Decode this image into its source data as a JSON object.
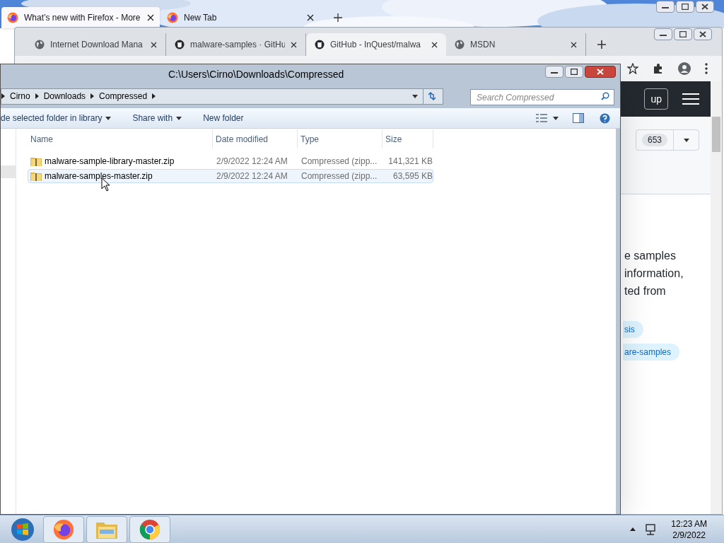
{
  "firefox": {
    "tabs": [
      {
        "title": "What’s new with Firefox - More",
        "selected": true
      },
      {
        "title": "New Tab",
        "selected": false
      }
    ]
  },
  "chrome": {
    "tabs": [
      {
        "title": "Internet Download Mana",
        "kind": "globe",
        "selected": false
      },
      {
        "title": "malware-samples · GitHu",
        "kind": "github",
        "selected": false
      },
      {
        "title": "GitHub - InQuest/malwa",
        "kind": "github",
        "selected": true
      },
      {
        "title": "MSDN",
        "kind": "globe",
        "selected": false
      }
    ],
    "page": {
      "header_button": "up",
      "count": "653",
      "text_lines": [
        "e samples",
        "information,",
        "ted from"
      ],
      "tags": [
        "sis",
        "are-samples"
      ]
    }
  },
  "explorer": {
    "title": "C:\\Users\\Cirno\\Downloads\\Compressed",
    "breadcrumb": [
      "Cirno",
      "Downloads",
      "Compressed"
    ],
    "search": {
      "placeholder": "Search Compressed"
    },
    "toolbar": [
      {
        "label": "de selected folder in library",
        "dropdown": true
      },
      {
        "label": "Share with",
        "dropdown": true
      },
      {
        "label": "New folder",
        "dropdown": false
      }
    ],
    "columns": [
      "Name",
      "Date modified",
      "Type",
      "Size"
    ],
    "rows": [
      {
        "name": "malware-sample-library-master.zip",
        "date": "2/9/2022 12:24 AM",
        "type": "Compressed (zipp...",
        "size": "141,321 KB",
        "selected": false
      },
      {
        "name": "malware-samples-master.zip",
        "date": "2/9/2022 12:24 AM",
        "type": "Compressed (zipp...",
        "size": "63,595 KB",
        "selected": true
      }
    ]
  },
  "taskbar": {
    "apps": [
      {
        "kind": "firefox"
      },
      {
        "kind": "explorer"
      },
      {
        "kind": "chrome"
      }
    ],
    "clock": {
      "time": "12:23 AM",
      "date": "2/9/2022"
    }
  }
}
